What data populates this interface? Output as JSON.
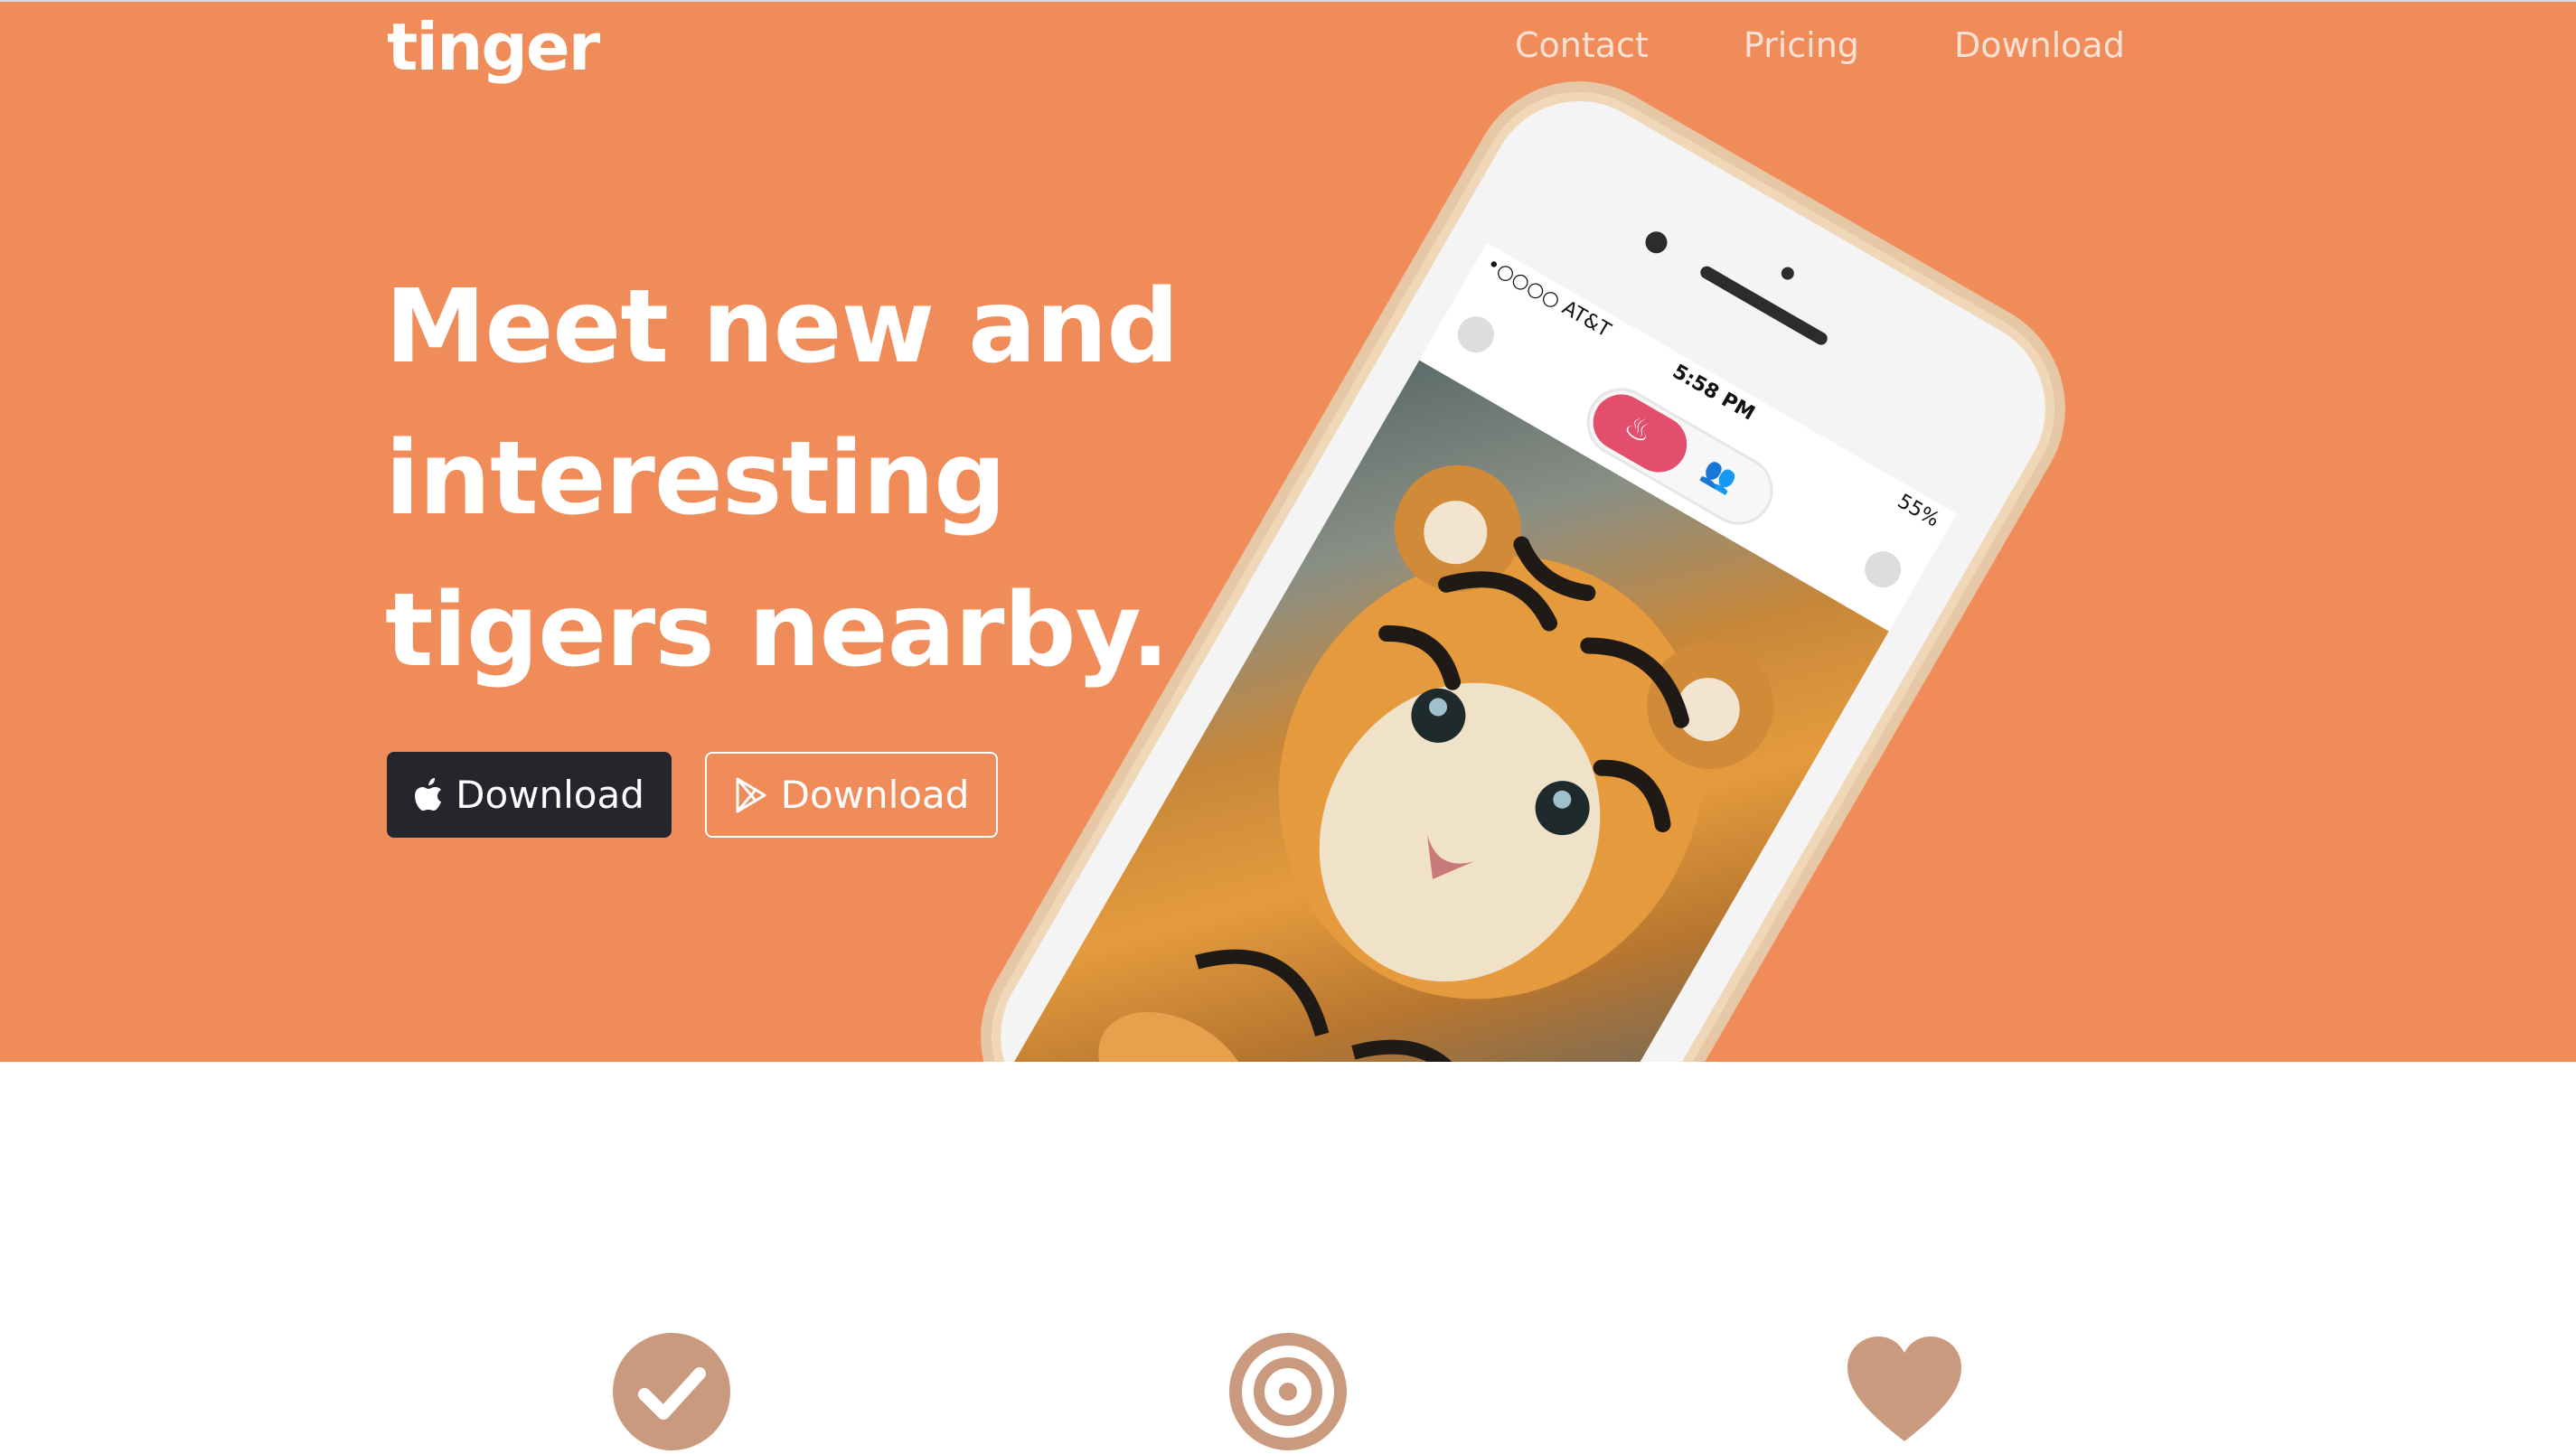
{
  "brand": {
    "name": "tinger"
  },
  "nav": {
    "items": [
      {
        "label": "Contact"
      },
      {
        "label": "Pricing"
      },
      {
        "label": "Download"
      }
    ]
  },
  "hero": {
    "headline_lines": [
      "Meet new and",
      "interesting",
      "tigers nearby."
    ],
    "buttons": {
      "apple": {
        "label": "Download",
        "icon": "apple-icon"
      },
      "play": {
        "label": "Download",
        "icon": "play-store-icon"
      }
    }
  },
  "phone": {
    "carrier": "•○○○○ AT&T",
    "time": "5:58 PM",
    "battery": "55%"
  },
  "features": {
    "icons": [
      "check-circle-icon",
      "target-icon",
      "heart-icon"
    ]
  },
  "colors": {
    "hero_bg": "#ef8c5a",
    "apple_button": "#24262b",
    "feature_icon": "#c99a7e"
  }
}
